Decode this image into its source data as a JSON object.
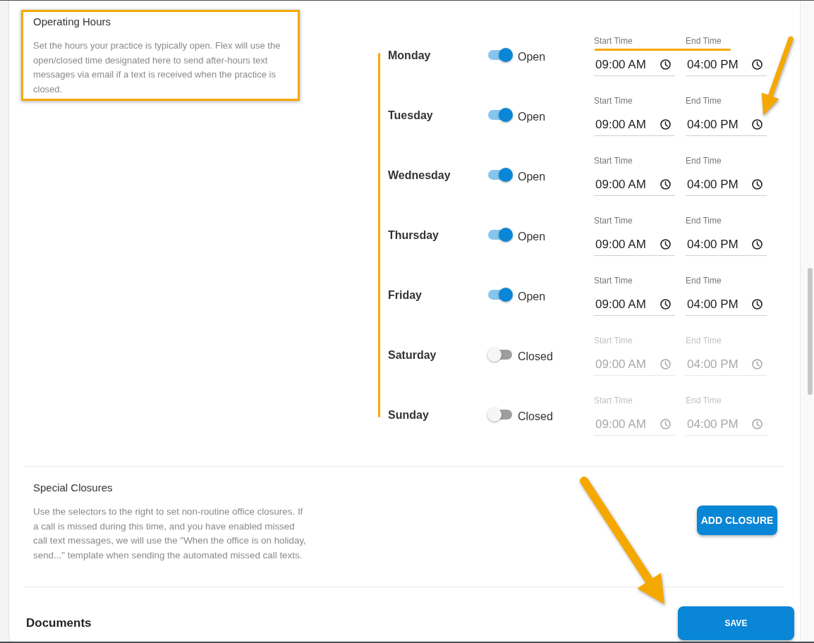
{
  "operating_hours": {
    "title": "Operating Hours",
    "description": "Set the hours your practice is typically open. Flex will use the open/closed time designated here to send after-hours text messages via email if a text is received when the practice is closed."
  },
  "days": [
    {
      "name": "Monday",
      "open": true,
      "status": "Open",
      "start": {
        "label": "Start Time",
        "value": "09:00 AM"
      },
      "end": {
        "label": "End Time",
        "value": "04:00 PM"
      }
    },
    {
      "name": "Tuesday",
      "open": true,
      "status": "Open",
      "start": {
        "label": "Start Time",
        "value": "09:00 AM"
      },
      "end": {
        "label": "End Time",
        "value": "04:00 PM"
      }
    },
    {
      "name": "Wednesday",
      "open": true,
      "status": "Open",
      "start": {
        "label": "Start Time",
        "value": "09:00 AM"
      },
      "end": {
        "label": "End Time",
        "value": "04:00 PM"
      }
    },
    {
      "name": "Thursday",
      "open": true,
      "status": "Open",
      "start": {
        "label": "Start Time",
        "value": "09:00 AM"
      },
      "end": {
        "label": "End Time",
        "value": "04:00 PM"
      }
    },
    {
      "name": "Friday",
      "open": true,
      "status": "Open",
      "start": {
        "label": "Start Time",
        "value": "09:00 AM"
      },
      "end": {
        "label": "End Time",
        "value": "04:00 PM"
      }
    },
    {
      "name": "Saturday",
      "open": false,
      "status": "Closed",
      "start": {
        "label": "Start Time",
        "value": "09:00 AM"
      },
      "end": {
        "label": "End Time",
        "value": "04:00 PM"
      }
    },
    {
      "name": "Sunday",
      "open": false,
      "status": "Closed",
      "start": {
        "label": "Start Time",
        "value": "09:00 AM"
      },
      "end": {
        "label": "End Time",
        "value": "04:00 PM"
      }
    }
  ],
  "special_closures": {
    "title": "Special Closures",
    "description": "Use the selectors to the right to set non-routine office closures. If a call is missed during this time, and you have enabled missed call text messages, we will use the \"When the office is on holiday, send...\" template when sending the automated missed call texts.",
    "button": "ADD CLOSURE"
  },
  "documents": {
    "title": "Documents",
    "button": "SAVE"
  }
}
